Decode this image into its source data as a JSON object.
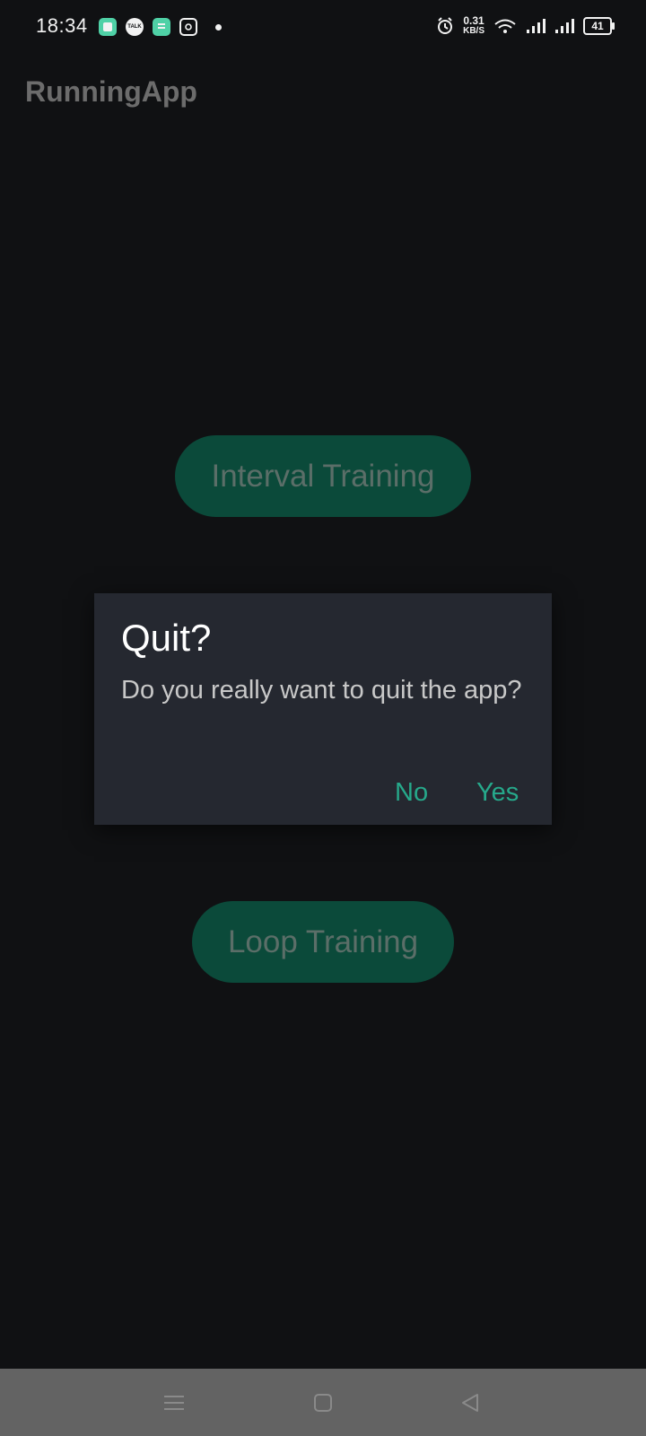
{
  "status_bar": {
    "time": "18:34",
    "notification_icons": [
      "gallery-icon",
      "kakaotalk-icon",
      "notes-icon",
      "instagram-icon",
      "more-dot-icon"
    ],
    "kakaotalk_text": "TALK",
    "net_speed_value": "0.31",
    "net_speed_unit": "KB/S",
    "battery_level": "41",
    "system_icons": [
      "alarm-icon",
      "wifi-icon",
      "signal-icon",
      "signal-icon"
    ]
  },
  "app_bar": {
    "title": "RunningApp"
  },
  "main": {
    "interval_button_label": "Interval Training",
    "loop_button_label": "Loop Training"
  },
  "dialog": {
    "title": "Quit?",
    "message": "Do you really want to quit the app?",
    "negative_label": "No",
    "positive_label": "Yes"
  },
  "nav_bar": {
    "items": [
      "menu-icon",
      "home-icon",
      "back-icon"
    ]
  },
  "colors": {
    "background": "#101113",
    "accent": "#26a98b",
    "button_fill": "#0b4a3a",
    "dialog_background": "#252830",
    "nav_bar": "#636363"
  }
}
